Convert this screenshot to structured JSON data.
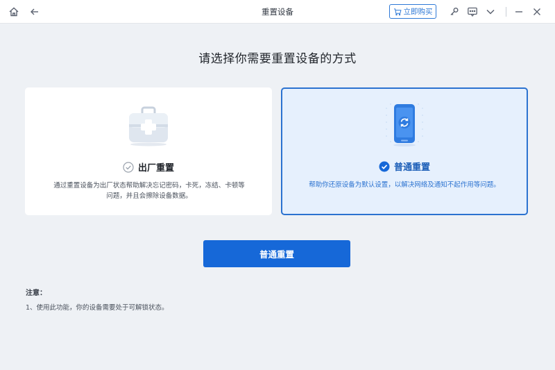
{
  "window": {
    "title": "重置设备",
    "buy_label": "立即购买"
  },
  "icons": {
    "home": "home-icon",
    "back": "back-arrow-icon",
    "cart": "cart-icon",
    "key": "key-icon",
    "feedback": "feedback-icon",
    "dropdown": "chevron-down-icon",
    "minimize": "minimize-icon",
    "close": "close-icon"
  },
  "main": {
    "heading": "请选择你需要重置设备的方式"
  },
  "options": [
    {
      "title": "出厂重置",
      "description": "通过重置设备为出厂状态帮助解决忘记密码，卡死，冻结、卡顿等问题，并且会擦除设备数据。",
      "selected": false
    },
    {
      "title": "普通重置",
      "description": "帮助你还原设备为默认设置，以解决网络及通知不起作用等问题。",
      "selected": true
    }
  ],
  "action": {
    "button_label": "普通重置"
  },
  "notes": {
    "title": "注意：",
    "items": [
      "1、使用此功能，你的设备需要处于可解锁状态。"
    ]
  },
  "colors": {
    "accent": "#1668d8",
    "selected_bg": "#e6f0fd",
    "page_bg": "#eef1f5"
  }
}
